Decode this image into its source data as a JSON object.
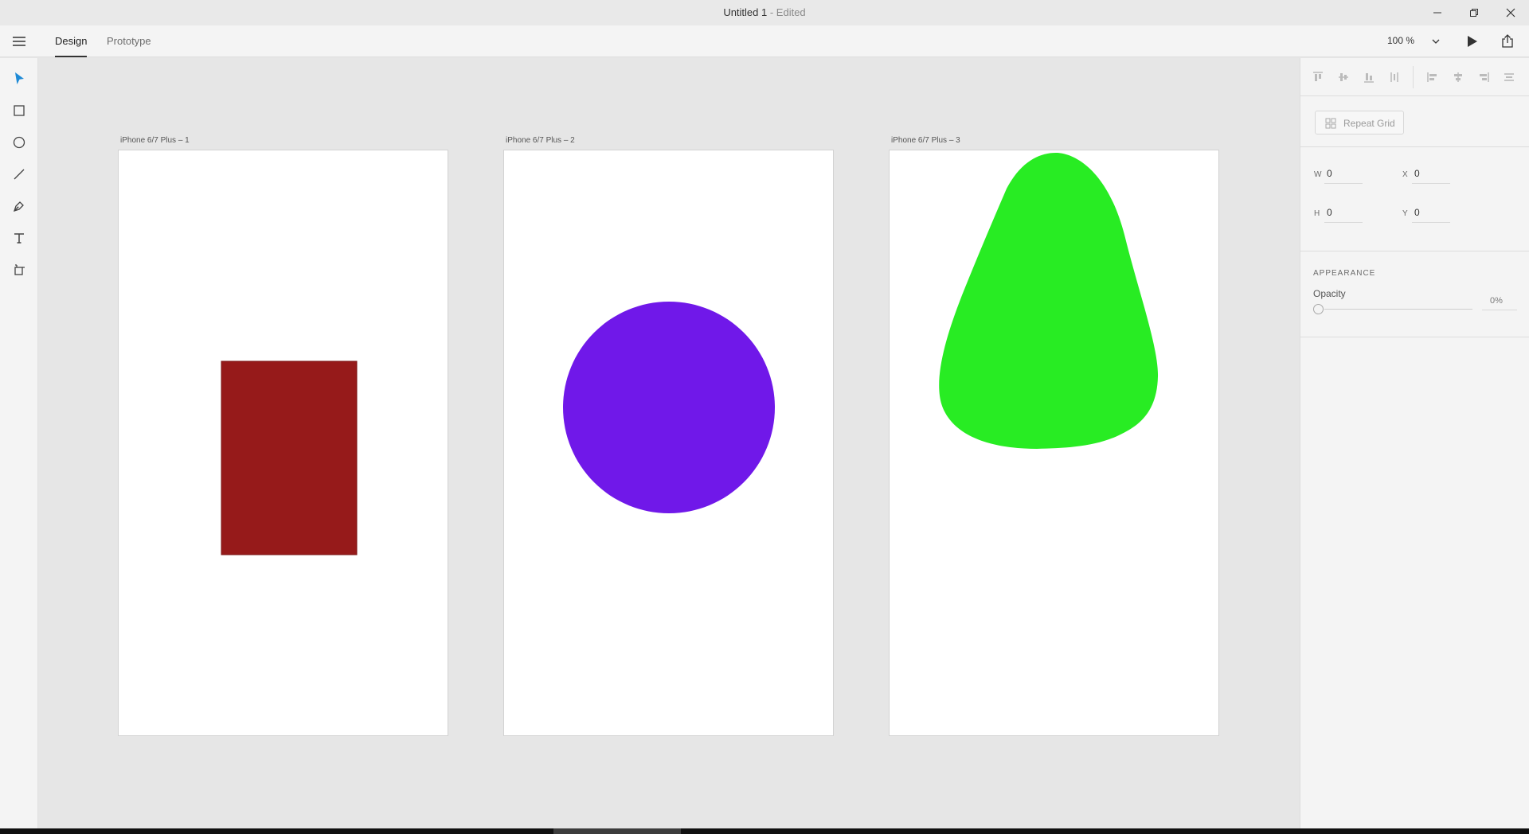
{
  "window": {
    "title": "Untitled 1",
    "title_separator": " - ",
    "title_state": "Edited"
  },
  "appbar": {
    "tabs": [
      {
        "label": "Design",
        "active": true
      },
      {
        "label": "Prototype",
        "active": false
      }
    ],
    "zoom": "100 %"
  },
  "tools": [
    "select-tool",
    "rectangle-tool",
    "ellipse-tool",
    "line-tool",
    "pen-tool",
    "text-tool",
    "artboard-tool"
  ],
  "artboards": [
    {
      "label": "iPhone 6/7 Plus – 1",
      "shape": "rectangle",
      "fill": "#961a1a"
    },
    {
      "label": "iPhone 6/7 Plus – 2",
      "shape": "ellipse",
      "fill": "#7018e9"
    },
    {
      "label": "iPhone 6/7 Plus – 3",
      "shape": "blob",
      "fill": "#28ec23"
    }
  ],
  "panel": {
    "repeat_grid_label": "Repeat Grid",
    "w_label": "W",
    "w_value": "0",
    "x_label": "X",
    "x_value": "0",
    "h_label": "H",
    "h_value": "0",
    "y_label": "Y",
    "y_value": "0",
    "appearance_title": "APPEARANCE",
    "opacity_label": "Opacity",
    "opacity_value": "0%"
  },
  "colors": {
    "accent": "#1e8ad6"
  }
}
